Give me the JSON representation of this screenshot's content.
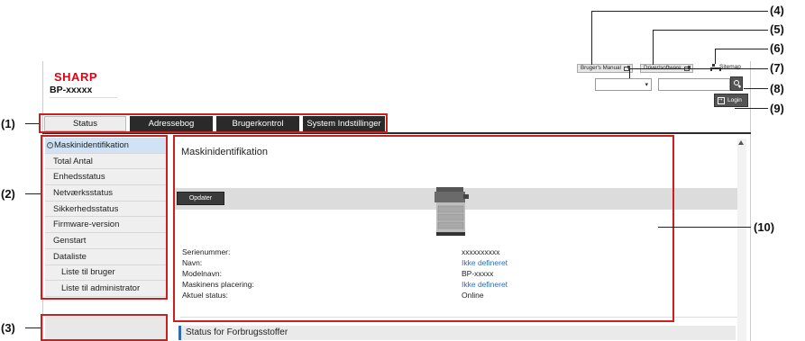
{
  "header": {
    "logo": "SHARP",
    "model": "BP-xxxxx",
    "manual_button": "Bruger's Manual",
    "driver_button": "Driver/software",
    "sitemap": "Sitemap",
    "login": "Login"
  },
  "tabs": [
    {
      "label": "Status"
    },
    {
      "label": "Adressebog"
    },
    {
      "label": "Brugerkontrol"
    },
    {
      "label": "System Indstillinger"
    }
  ],
  "sidebar": {
    "items": [
      {
        "label": "Maskinidentifikation"
      },
      {
        "label": "Total Antal"
      },
      {
        "label": "Enhedsstatus"
      },
      {
        "label": "Netværksstatus"
      },
      {
        "label": "Sikkerhedsstatus"
      },
      {
        "label": "Firmware-version"
      },
      {
        "label": "Genstart"
      },
      {
        "label": "Dataliste"
      },
      {
        "label": "Liste til bruger"
      },
      {
        "label": "Liste til administrator"
      }
    ]
  },
  "main": {
    "title": "Maskinidentifikation",
    "refresh_button": "Opdater",
    "rows": [
      {
        "label": "Serienummer:",
        "value": "xxxxxxxxxx"
      },
      {
        "label": "Navn:",
        "value": "Ikke defineret"
      },
      {
        "label": "Modelnavn:",
        "value": "BP-xxxxx"
      },
      {
        "label": "Maskinens placering:",
        "value": "Ikke defineret"
      },
      {
        "label": "Aktuel status:",
        "value": "Online"
      }
    ],
    "section2_title": "Status for Forbrugsstoffer"
  },
  "callouts": {
    "c1": "(1)",
    "c2": "(2)",
    "c3": "(3)",
    "c4": "(4)",
    "c5": "(5)",
    "c6": "(6)",
    "c7": "(7)",
    "c8": "(8)",
    "c9": "(9)",
    "c10": "(10)"
  },
  "colors": {
    "brand": "#e60012",
    "callout": "#cc2020",
    "link": "#2c6bb8",
    "tab_dark": "#2a2a2a"
  }
}
